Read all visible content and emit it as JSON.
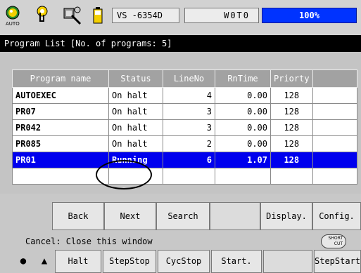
{
  "top_bar": {
    "auto_label": "AUTO",
    "mode_field": "VS  -6354D",
    "wot_field": "W0T0",
    "zoom_field": "100%"
  },
  "title_bar": {
    "text": "Program List  [No. of programs: 5]"
  },
  "table": {
    "headers": {
      "name": "Program name",
      "status": "Status",
      "line": "LineNo",
      "rntime": "RnTime",
      "priority": "Priorty"
    },
    "rows": [
      {
        "name": "AUTOEXEC",
        "status": "On halt",
        "line": "4",
        "rntime": "0.00",
        "priority": "128"
      },
      {
        "name": "PR07",
        "status": "On halt",
        "line": "3",
        "rntime": "0.00",
        "priority": "128"
      },
      {
        "name": "PR042",
        "status": "On halt",
        "line": "3",
        "rntime": "0.00",
        "priority": "128"
      },
      {
        "name": "PR085",
        "status": "On halt",
        "line": "2",
        "rntime": "0.00",
        "priority": "128"
      },
      {
        "name": "PR01",
        "status": "Running",
        "line": "6",
        "rntime": "1.07",
        "priority": "128"
      }
    ],
    "selected_row": 4
  },
  "function_keys_1": {
    "back": "Back",
    "next": "Next",
    "search": "Search",
    "display": "Display.",
    "config": "Config."
  },
  "message": {
    "text": "Cancel: Close this window",
    "shortcut_top": "SHORT",
    "shortcut_bottom": "CUT"
  },
  "function_keys_2": {
    "halt": "Halt",
    "stepstop": "StepStop",
    "cycstop": "CycStop",
    "start": "Start.",
    "stepstart": "StepStart",
    "dot_symbol": "●",
    "up_symbol": "▲"
  },
  "colors": {
    "accent_blue": "#0000ee",
    "zoom_blue": "#0033ff",
    "title_bg": "#000000",
    "header_bg": "#a2a2a2"
  }
}
